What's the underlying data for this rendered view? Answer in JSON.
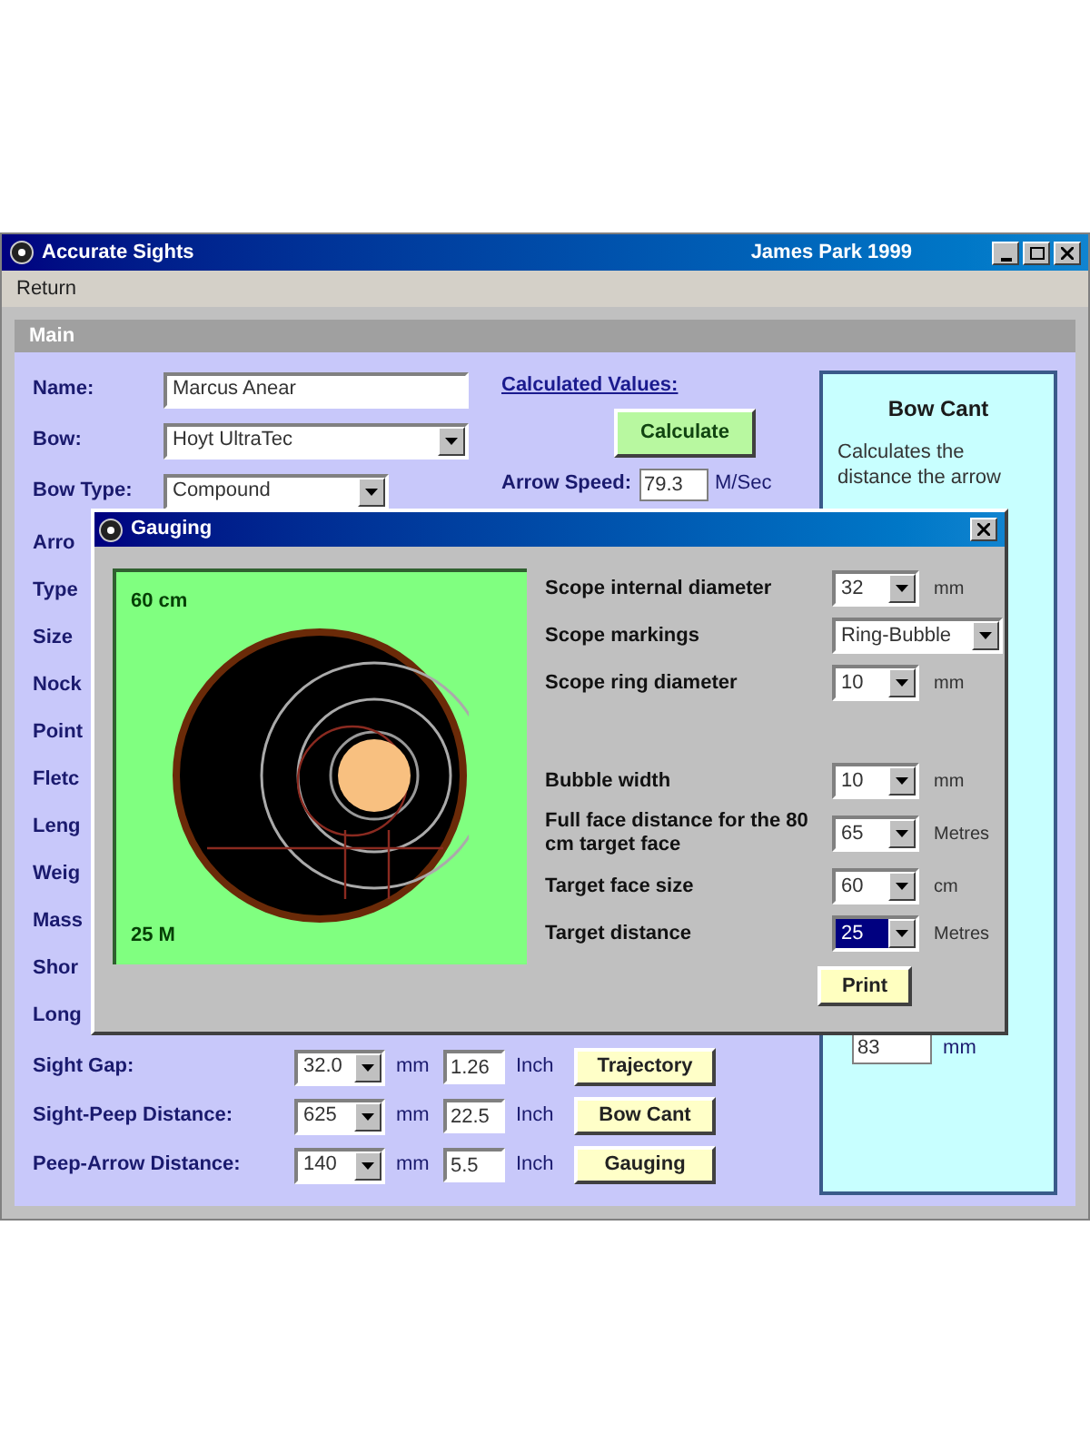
{
  "window": {
    "title": "Accurate Sights",
    "author": "James Park 1999"
  },
  "menu": [
    "Return"
  ],
  "tab": "Main",
  "form": [
    {
      "label": "Name:",
      "value": "Marcus Anear",
      "kind": "input"
    },
    {
      "label": "Bow:",
      "value": "Hoyt UltraTec",
      "kind": "select"
    },
    {
      "label": "Bow Type:",
      "value": "Compound",
      "kind": "select"
    }
  ],
  "hidden_labels": [
    "Arro",
    "Type",
    "Size",
    "Nock",
    "Point",
    "Fletc",
    "Leng",
    "Weig",
    "Mass",
    "Shor",
    "Long"
  ],
  "calculated": {
    "heading": "Calculated Values:",
    "button": "Calculate",
    "speed_label": "Arrow Speed:",
    "speed": "79.3",
    "speed_unit": "M/Sec"
  },
  "sight_rows": [
    {
      "label": "Sight Gap:",
      "value": "32.0",
      "unit": "mm",
      "inches": "1.26",
      "inch_unit": "Inch",
      "button": "Trajectory"
    },
    {
      "label": "Sight-Peep Distance:",
      "value": "625",
      "unit": "mm",
      "inches": "22.5",
      "inch_unit": "Inch",
      "button": "Bow Cant"
    },
    {
      "label": "Peep-Arrow Distance:",
      "value": "140",
      "unit": "mm",
      "inches": "5.5",
      "inch_unit": "Inch",
      "button": "Gauging"
    }
  ],
  "bow_cant": {
    "title": "Bow Cant",
    "description": "Calculates the distance the arrow",
    "value": "83",
    "unit": "mm"
  },
  "dialog": {
    "title": "Gauging",
    "top_label": "60 cm",
    "bottom_label": "25 M",
    "fields": [
      {
        "label": "Scope internal diameter",
        "value": "32",
        "unit": "mm",
        "highlighted": false
      },
      {
        "label": "Scope markings",
        "value": "Ring-Bubble",
        "highlighted": false
      },
      {
        "label": "Scope ring diameter",
        "value": "10",
        "unit": "mm",
        "highlighted": false
      },
      {
        "label": "Bubble width",
        "value": "10",
        "unit": "mm",
        "highlighted": false
      },
      {
        "label": "Full face distance for the 80 cm target face",
        "value": "65",
        "unit": "Metres",
        "highlighted": false
      },
      {
        "label": "Target face size",
        "value": "60",
        "unit": "cm",
        "highlighted": false
      },
      {
        "label": "Target distance",
        "value": "25",
        "unit": "Metres",
        "highlighted": true
      }
    ],
    "button": "Print"
  }
}
